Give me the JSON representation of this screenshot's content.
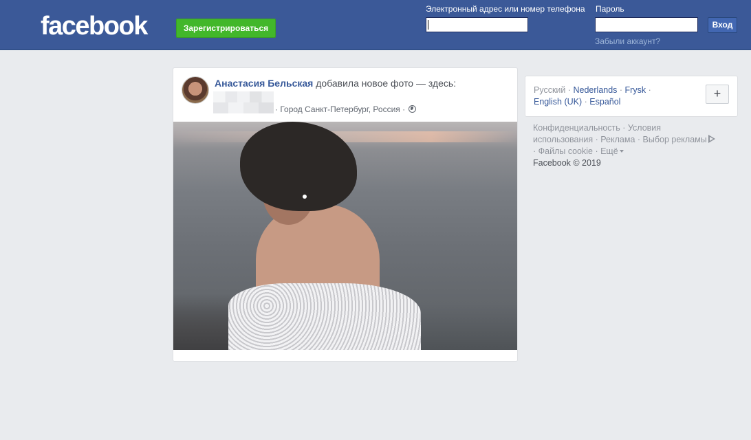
{
  "header": {
    "logo": "facebook",
    "signup_label": "Зарегистрироваться",
    "email_label": "Электронный адрес или номер телефона",
    "email_value": "",
    "password_label": "Пароль",
    "password_value": "",
    "login_label": "Вход",
    "forgot_label": "Забыли аккаунт?",
    "colors": {
      "bar": "#3b5998",
      "signup": "#42b72a",
      "login": "#4267b2"
    }
  },
  "post": {
    "author": "Анастасия Бельская",
    "action": " добавила новое фото — здесь:",
    "location": "· Город Санкт-Петербург, Россия ·",
    "privacy_icon": "globe-icon"
  },
  "languages": {
    "current": "Русский",
    "sep": " · ",
    "items": [
      "Nederlands",
      "Frysk",
      "English (UK)",
      "Español"
    ],
    "more_icon": "plus-icon",
    "more_label": "+"
  },
  "footer": {
    "privacy": "Конфиденциальность",
    "terms": "Условия использования",
    "terms_1": "Условия",
    "terms_2": "использования",
    "ads": "Реклама",
    "ad_choices": "Выбор рекламы",
    "cookies": "Файлы cookie",
    "more": "Ещё",
    "copyright": "Facebook © 2019"
  }
}
